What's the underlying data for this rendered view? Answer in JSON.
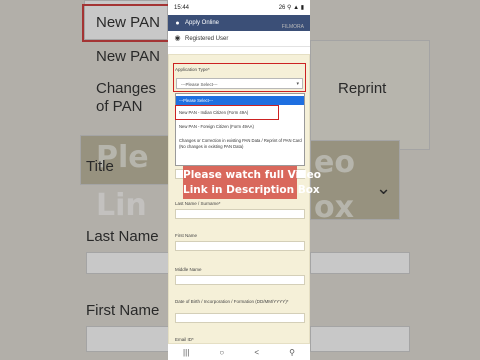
{
  "status_bar": {
    "time": "15:44",
    "right": "26 ⚲ ▲ ▮"
  },
  "watermark": "FILMORA",
  "menu": [
    {
      "label": "Apply Online",
      "icon": "person-icon",
      "active": true
    },
    {
      "label": "Registered User",
      "icon": "user-lock-icon",
      "active": false
    }
  ],
  "form": {
    "application_type_label": "Application Type*",
    "select_value": "---Please Select---",
    "dropdown_options": [
      "---Please Select---",
      "New PAN - Indian Citizen (Form 49A)",
      "New PAN - Foreign Citizen (Form 49AA)",
      "Changes or Correction in existing PAN Data / Reprint of PAN Card (No changes in existing PAN Data)"
    ],
    "title_label": "Title*",
    "last_name_label": "Last Name / Surname*",
    "first_name_label": "First Name",
    "middle_name_label": "Middle Name",
    "dob_label": "Date of Birth / Incorporation / Formation (DD/MM/YYYY)*",
    "email_label": "Email ID*"
  },
  "caption": {
    "line1": "Please watch full Video",
    "line2": "Link in Description Box"
  },
  "background": {
    "left_items": [
      "New PAN",
      "New PAN",
      "Changes",
      "of PAN",
      "Title",
      "Last Name",
      "First Name"
    ],
    "right_items": [
      "Reprint",
      "eo",
      "ox"
    ],
    "big_left": [
      "Ple",
      "Lin"
    ]
  },
  "navbar": [
    "|||",
    "○",
    "<",
    "⚲"
  ]
}
